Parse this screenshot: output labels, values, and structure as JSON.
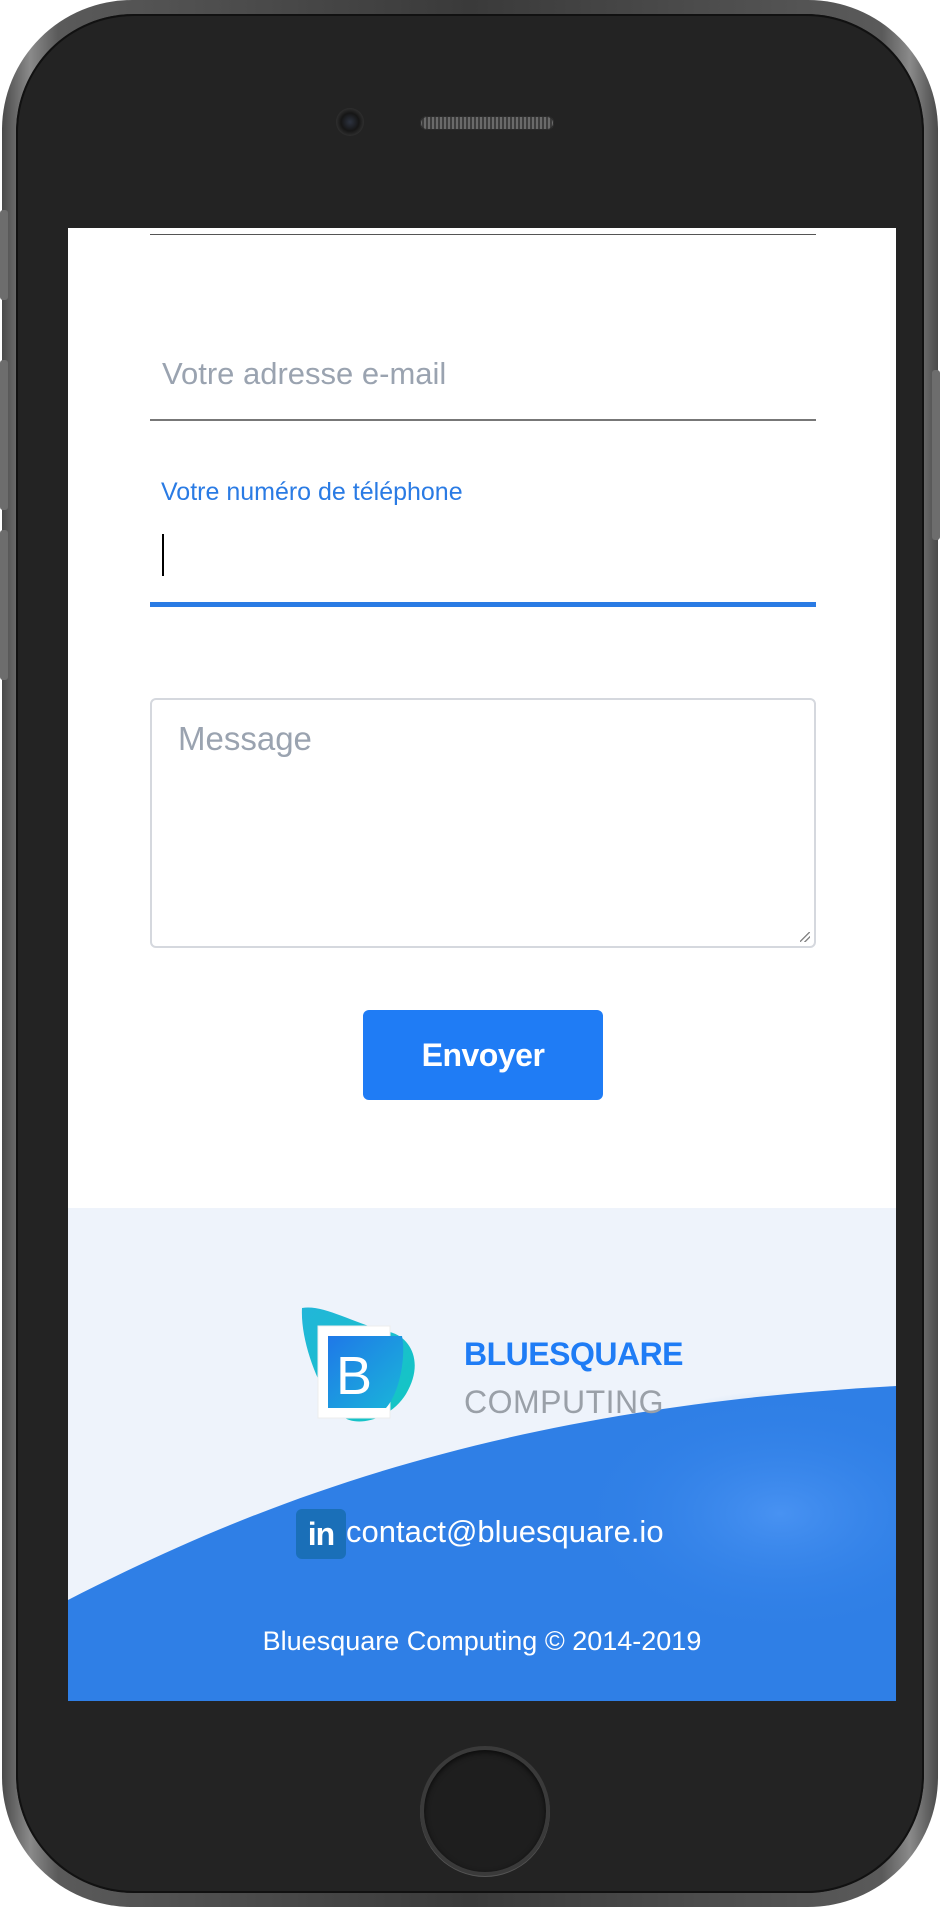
{
  "form": {
    "email_placeholder": "Votre adresse e-mail",
    "phone_label": "Votre numéro de téléphone",
    "phone_value": "",
    "message_placeholder": "Message",
    "submit_label": "Envoyer"
  },
  "footer": {
    "brand_letter": "B",
    "brand_name": "BLUESQUARE",
    "brand_sub": "COMPUTING",
    "linkedin_text": "in",
    "contact_email": "contact@bluesquare.io",
    "copyright": "Bluesquare Computing © 2014-2019"
  },
  "colors": {
    "accent": "#1f7cf5",
    "label_blue": "#2a7be4",
    "footer_bg": "#eef3fb",
    "footer_wave": "#2f7fe6",
    "linkedin": "#1a6fb8"
  },
  "icons": {
    "linkedin": "linkedin-icon",
    "logo": "bluesquare-logo-icon"
  }
}
